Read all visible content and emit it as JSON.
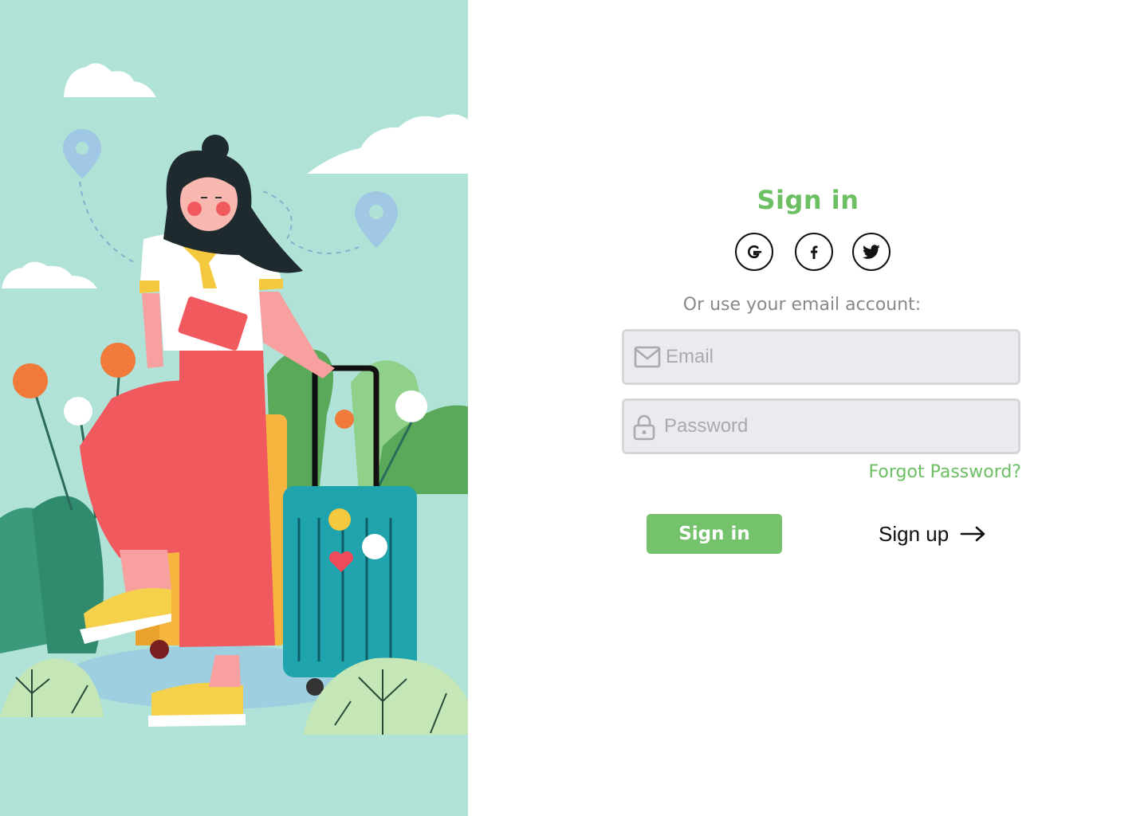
{
  "signin": {
    "title": "Sign in",
    "social": [
      {
        "label": "G",
        "icon": "google-icon"
      },
      {
        "label": "f",
        "icon": "facebook-icon"
      },
      {
        "label": "",
        "icon": "twitter-icon"
      }
    ],
    "hint": "Or use your email account:",
    "email": {
      "placeholder": "Email",
      "icon": "mail-icon"
    },
    "password": {
      "placeholder": "Password",
      "icon": "lock-icon"
    },
    "forgot_label": "Forgot Password?",
    "submit_label": "Sign in",
    "signup_label": "Sign up",
    "signup_icon": "arrow-right-icon"
  },
  "colors": {
    "accent": "#6cbf63",
    "button": "#75c26c",
    "illustration_bg": "#b0e2d8",
    "field_bg": "#ebebef"
  }
}
